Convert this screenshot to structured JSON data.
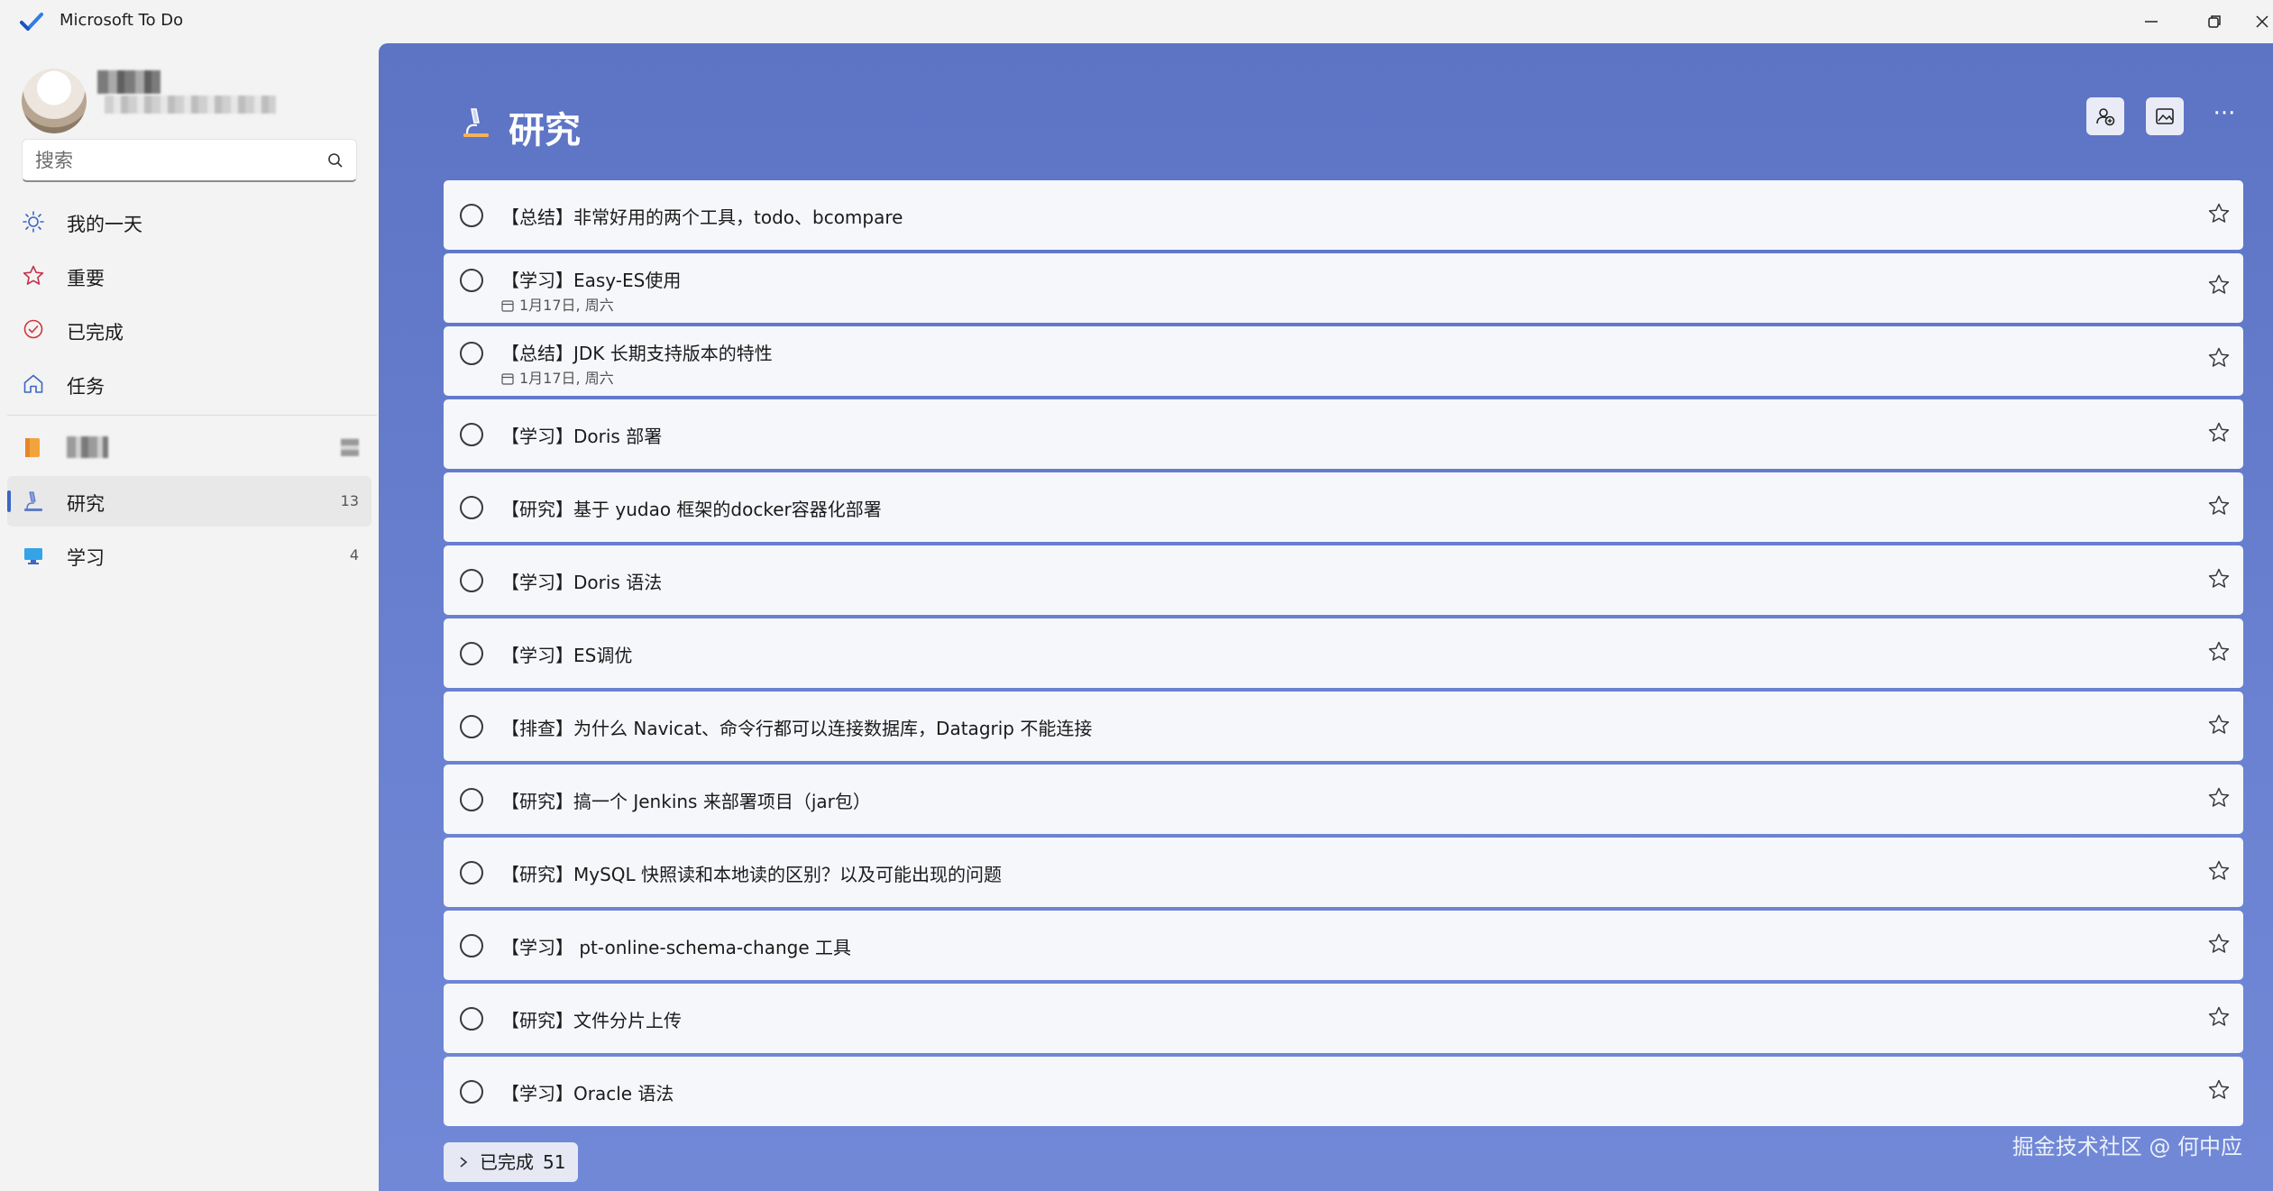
{
  "app": {
    "title": "Microsoft To Do"
  },
  "sidebar": {
    "search_placeholder": "搜索",
    "smart_lists": [
      {
        "label": "我的一天",
        "icon": "sun-icon"
      },
      {
        "label": "重要",
        "icon": "star-icon"
      },
      {
        "label": "已完成",
        "icon": "check-circle-icon"
      },
      {
        "label": "任务",
        "icon": "home-icon"
      }
    ],
    "lists": [
      {
        "label": "研究",
        "count": "13",
        "icon": "microscope-icon",
        "selected": true
      },
      {
        "label": "学习",
        "count": "4",
        "icon": "monitor-icon"
      }
    ]
  },
  "main": {
    "list_title": "研究",
    "more_label": "···",
    "tasks": [
      {
        "title": "【总结】非常好用的两个工具，todo、bcompare",
        "date": ""
      },
      {
        "title": "【学习】Easy-ES使用",
        "date": "1月17日, 周六"
      },
      {
        "title": "【总结】JDK 长期支持版本的特性",
        "date": "1月17日, 周六"
      },
      {
        "title": "【学习】Doris 部署",
        "date": ""
      },
      {
        "title": "【研究】基于 yudao 框架的docker容器化部署",
        "date": ""
      },
      {
        "title": "【学习】Doris 语法",
        "date": ""
      },
      {
        "title": "【学习】ES调优",
        "date": ""
      },
      {
        "title": "【排查】为什么 Navicat、命令行都可以连接数据库，Datagrip 不能连接",
        "date": ""
      },
      {
        "title": "【研究】搞一个 Jenkins 来部署项目（jar包）",
        "date": ""
      },
      {
        "title": "【研究】MySQL 快照读和本地读的区别？以及可能出现的问题",
        "date": ""
      },
      {
        "title": "【学习】 pt-online-schema-change 工具",
        "date": ""
      },
      {
        "title": "【研究】文件分片上传",
        "date": ""
      },
      {
        "title": "【学习】Oracle 语法",
        "date": ""
      }
    ],
    "completed": {
      "label": "已完成",
      "count": "51"
    }
  },
  "watermark": "掘金技术社区 @ 何中应",
  "colors": {
    "accent": "#3b66c4",
    "main_bg": "#6276c8",
    "task_bg": "#f6f7fb"
  }
}
